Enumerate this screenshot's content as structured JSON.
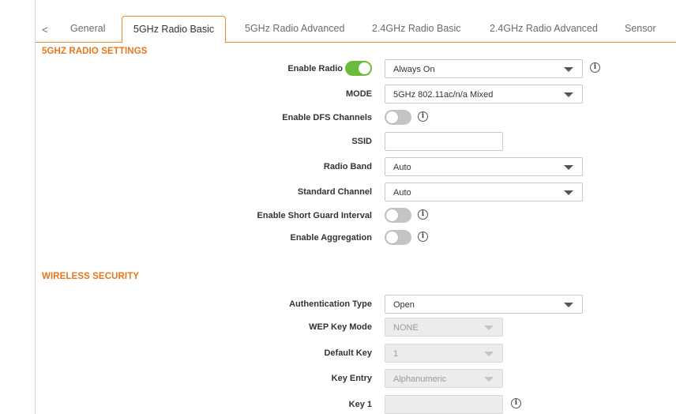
{
  "tabs": {
    "prev_glyph": "<",
    "items": [
      {
        "label": "General"
      },
      {
        "label": "5GHz Radio Basic",
        "active": true
      },
      {
        "label": "5GHz Radio Advanced"
      },
      {
        "label": "2.4GHz Radio Basic"
      },
      {
        "label": "2.4GHz Radio Advanced"
      },
      {
        "label": "Sensor"
      }
    ]
  },
  "radio_settings": {
    "title": "5GHZ RADIO SETTINGS",
    "enable_radio": {
      "label": "Enable Radio",
      "on": true,
      "schedule": "Always On"
    },
    "mode": {
      "label": "MODE",
      "value": "5GHz 802.11ac/n/a Mixed"
    },
    "enable_dfs": {
      "label": "Enable DFS Channels",
      "on": false
    },
    "ssid": {
      "label": "SSID",
      "value": ""
    },
    "radio_band": {
      "label": "Radio Band",
      "value": "Auto"
    },
    "standard_channel": {
      "label": "Standard Channel",
      "value": "Auto"
    },
    "short_guard": {
      "label": "Enable Short Guard Interval",
      "on": false
    },
    "aggregation": {
      "label": "Enable Aggregation",
      "on": false
    }
  },
  "wireless_security": {
    "title": "WIRELESS SECURITY",
    "auth_type": {
      "label": "Authentication Type",
      "value": "Open"
    },
    "wep_key_mode": {
      "label": "WEP Key Mode",
      "value": "NONE"
    },
    "default_key": {
      "label": "Default Key",
      "value": "1"
    },
    "key_entry": {
      "label": "Key Entry",
      "value": "Alphanumeric"
    },
    "key1": {
      "label": "Key 1",
      "value": ""
    }
  },
  "info_glyph": "i",
  "colors": {
    "accent": "#e8761c",
    "toggle_on": "#6cbb3c",
    "toggle_off": "#c4c4c4"
  }
}
